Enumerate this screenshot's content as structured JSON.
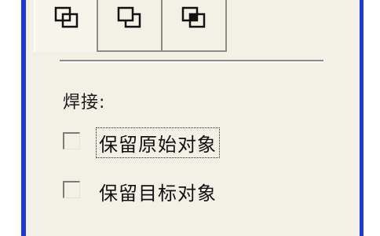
{
  "toolbar": {
    "icons": [
      "intersect-shapes-icon",
      "subtract-shapes-icon",
      "front-minus-back-icon"
    ],
    "selected_index": 0
  },
  "weld": {
    "section_label": "焊接:",
    "options": [
      {
        "label": "保留原始对象",
        "checked": false,
        "focused": true
      },
      {
        "label": "保留目标对象",
        "checked": false,
        "focused": false
      }
    ]
  },
  "colors": {
    "window_border": "#1e3ad6",
    "panel_bg": "#f3f1e6"
  }
}
